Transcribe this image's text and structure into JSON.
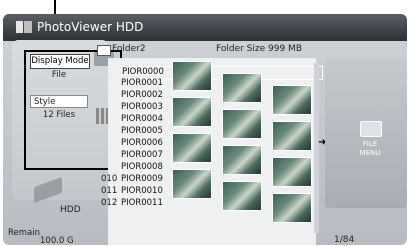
{
  "window": {
    "title": "PhotoViewer HDD"
  },
  "folder": {
    "name": "Folder2",
    "size_label": "Folder Size 999 MB"
  },
  "left_panel": {
    "display_mode_label": "Display Mode",
    "display_mode_value": "File",
    "style_label": "Style",
    "style_value": "12 Files"
  },
  "storage": {
    "device": "HDD",
    "remain_label": "Remain",
    "remain_value": "100.0 G"
  },
  "files": [
    {
      "index": "",
      "name": "PIOR0000"
    },
    {
      "index": "",
      "name": "PIOR0001"
    },
    {
      "index": "",
      "name": "PIOR0002"
    },
    {
      "index": "",
      "name": "PIOR0003"
    },
    {
      "index": "",
      "name": "PIOR0004"
    },
    {
      "index": "",
      "name": "PIOR0005"
    },
    {
      "index": "",
      "name": "PIOR0006"
    },
    {
      "index": "",
      "name": "PIOR0007"
    },
    {
      "index": "",
      "name": "PIOR0008"
    },
    {
      "index": "010",
      "name": "PIOR0009"
    },
    {
      "index": "011",
      "name": "PIOR0010"
    },
    {
      "index": "012",
      "name": "PIOR0011"
    }
  ],
  "right_panel": {
    "menu_label_1": "FILE",
    "menu_label_2": "MENU"
  },
  "pager": {
    "page": "1/84"
  }
}
